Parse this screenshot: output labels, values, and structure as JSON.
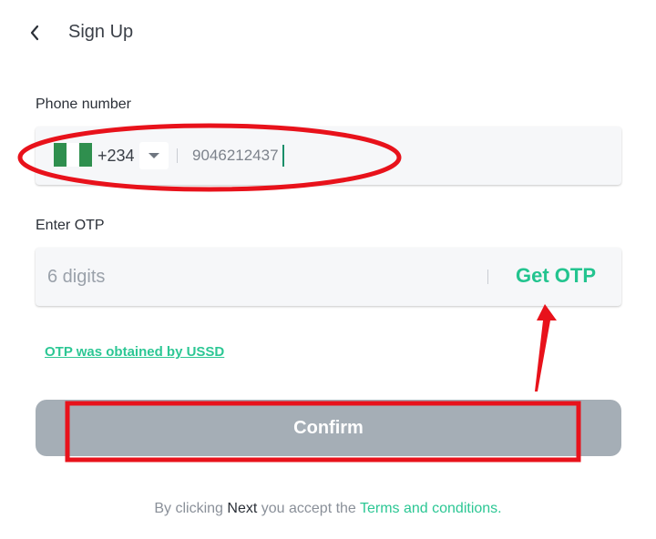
{
  "header": {
    "back_icon": "chevron-left-icon",
    "title": "Sign Up"
  },
  "phone": {
    "label": "Phone number",
    "country_flag": "nigeria-flag",
    "country_code": "+234",
    "dropdown_icon": "caret-down-icon",
    "value": "9046212437"
  },
  "otp": {
    "label": "Enter OTP",
    "placeholder": "6 digits",
    "value": "",
    "get_otp_label": "Get OTP"
  },
  "ussd_link": "OTP was obtained by USSD",
  "confirm_label": "Confirm",
  "footer": {
    "prefix": "By clicking ",
    "strong": "Next",
    "middle": " you accept the ",
    "link": "Terms and conditions."
  },
  "colors": {
    "accent": "#23c48f",
    "button_disabled": "#a5aeb6",
    "field_bg": "#f6f7f9",
    "annotation_red": "#e8121b",
    "flag_green": "#2f8f4e"
  }
}
